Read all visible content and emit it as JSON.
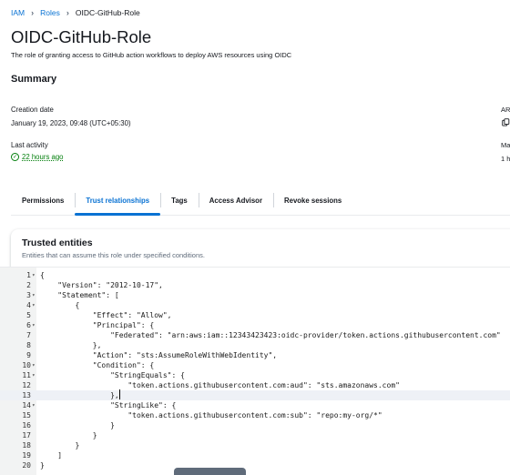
{
  "breadcrumb": {
    "root": "IAM",
    "parent": "Roles",
    "current": "OIDC-GitHub-Role"
  },
  "page": {
    "title": "OIDC-GitHub-Role",
    "description": "The role of granting access to GitHub action workflows to deploy AWS resources using OIDC"
  },
  "summary": {
    "title": "Summary",
    "creation_label": "Creation date",
    "creation_value": "January 19, 2023, 09:48 (UTC+05:30)",
    "activity_label": "Last activity",
    "activity_value": "22 hours ago",
    "clipped": {
      "top_label": "AR",
      "mid_label": "Ma",
      "mid_value": "1 h"
    }
  },
  "tabs": [
    "Permissions",
    "Trust relationships",
    "Tags",
    "Access Advisor",
    "Revoke sessions"
  ],
  "active_tab": "Trust relationships",
  "trusted_entities": {
    "title": "Trusted entities",
    "description": "Entities that can assume this role under specified conditions."
  },
  "code_lines": [
    "{",
    "    \"Version\": \"2012-10-17\",",
    "    \"Statement\": [",
    "        {",
    "            \"Effect\": \"Allow\",",
    "            \"Principal\": {",
    "                \"Federated\": \"arn:aws:iam::12343423423:oidc-provider/token.actions.githubusercontent.com\"",
    "            },",
    "            \"Action\": \"sts:AssumeRoleWithWebIdentity\",",
    "            \"Condition\": {",
    "                \"StringEquals\": {",
    "                    \"token.actions.githubusercontent.com:aud\": \"sts.amazonaws.com\"",
    "                },",
    "                \"StringLike\": {",
    "                    \"token.actions.githubusercontent.com:sub\": \"repo:my-org/*\"",
    "                }",
    "            }",
    "        }",
    "    ]",
    "}"
  ],
  "fold_lines": [
    1,
    3,
    4,
    6,
    10,
    11,
    14
  ],
  "active_line": 13,
  "colors": {
    "link": "#0972d3",
    "success": "#037f0c",
    "text": "#16191f",
    "muted": "#5f6b7a"
  }
}
